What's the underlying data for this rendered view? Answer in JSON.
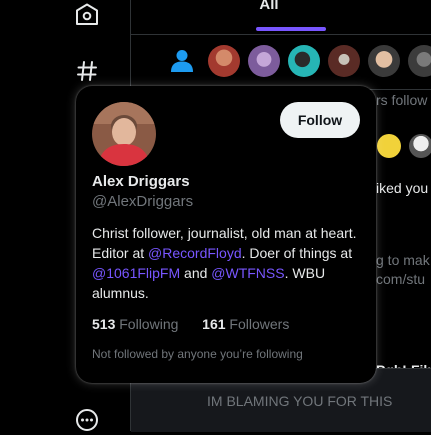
{
  "nav": {
    "icons": [
      "home-icon",
      "explore-hashtag-icon",
      "more-icon"
    ]
  },
  "tabs": [
    {
      "label": "All"
    }
  ],
  "background_fragments": {
    "followers_fragment": "rs follow",
    "liked_fragment": "iked you",
    "make_fragment": "g to mak",
    "url_fragment": "com/stu",
    "film_fragment": "PghLFilm",
    "bottom_text": "IM BLAMING YOU FOR THIS"
  },
  "hover_card": {
    "name": "Alex Driggars",
    "handle": "@AlexDriggars",
    "follow_label": "Follow",
    "bio": {
      "part1": "Christ follower, journalist, old man at heart. Editor at ",
      "link1": "@RecordFloyd",
      "part2": ". Doer of things at ",
      "link2": "@1061FlipFM",
      "part3": " and ",
      "link3": "@WTFNSS",
      "part4": ". WBU alumnus."
    },
    "following_count": "513",
    "following_label": "Following",
    "followers_count": "161",
    "followers_label": "Followers",
    "mutual_note": "Not followed by anyone you’re following"
  },
  "colors": {
    "accent": "#7856ff",
    "secondary_text": "#71767b",
    "primary_text": "#e7e9ea",
    "follow_button_bg": "#eff3f4"
  }
}
